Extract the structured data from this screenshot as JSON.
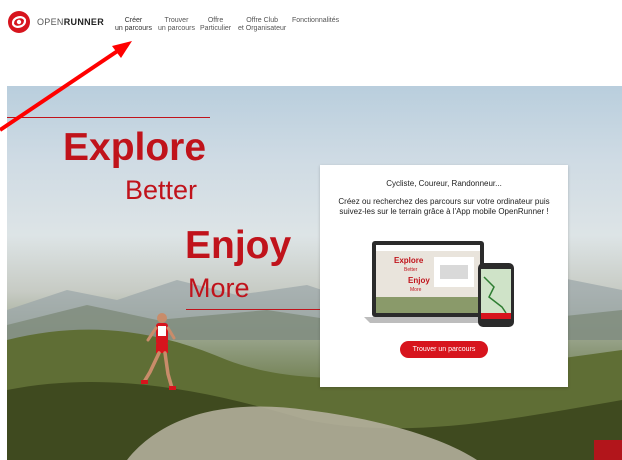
{
  "brand": {
    "logo_part1": "OPEN",
    "logo_part2": "RUNNER",
    "accent": "#d7141d"
  },
  "nav": [
    {
      "line1": "Créer",
      "line2": "un parcours"
    },
    {
      "line1": "Trouver",
      "line2": "un parcours"
    },
    {
      "line1": "Offre",
      "line2": "Particulier"
    },
    {
      "line1": "Offre Club",
      "line2": "et Organisateur"
    },
    {
      "line1": "Fonctionnalités",
      "line2": ""
    }
  ],
  "hero": {
    "explore": "Explore",
    "better": "Better",
    "enjoy": "Enjoy",
    "more": "More"
  },
  "card": {
    "title": "Cycliste, Coureur, Randonneur...",
    "description": "Créez ou recherchez des parcours sur votre ordinateur puis suivez-les sur le terrain grâce à l'App mobile OpenRunner !",
    "button": "Trouver un parcours",
    "laptop_explore": "Explore",
    "laptop_better": "Better",
    "laptop_enjoy": "Enjoy",
    "laptop_more": "More"
  },
  "annotation": {
    "arrow_color": "#ff0000"
  }
}
